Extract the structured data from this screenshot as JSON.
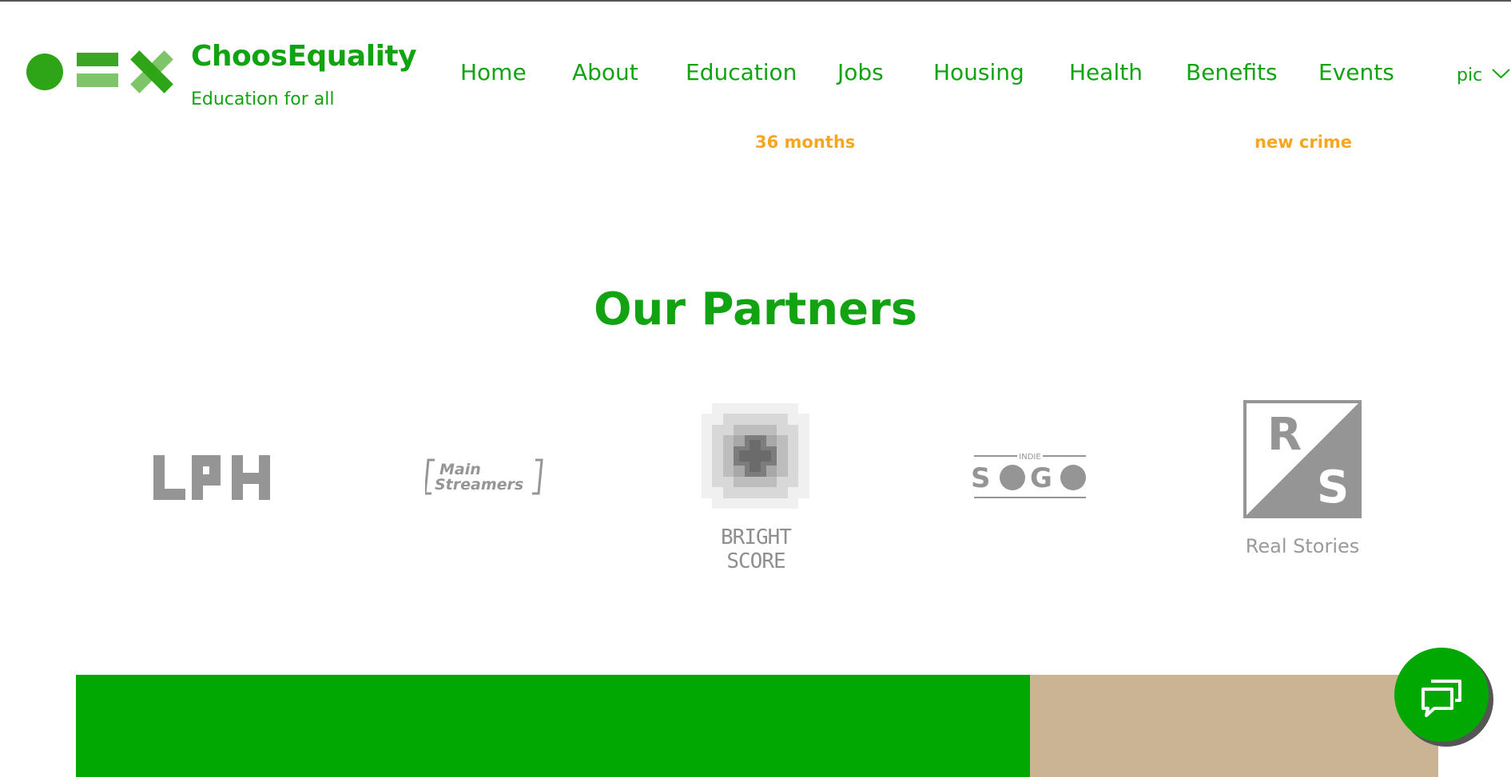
{
  "brand": {
    "name": "ChoosEquality",
    "tagline": "Education for all"
  },
  "nav": {
    "items": [
      {
        "label": "Home"
      },
      {
        "label": "About"
      },
      {
        "label": "Education"
      },
      {
        "label": "Jobs"
      },
      {
        "label": "Housing"
      },
      {
        "label": "Health"
      },
      {
        "label": "Benefits"
      },
      {
        "label": "Events"
      }
    ],
    "language": "pic"
  },
  "stats": {
    "fragment_left": "36 months",
    "fragment_right": "new crime"
  },
  "partners": {
    "title": "Our Partners",
    "logos": [
      {
        "name": "LPH",
        "icon": "lph-logo"
      },
      {
        "name": "Main Streamers",
        "line1": "Main",
        "line2": "Streamers",
        "icon": "main-streamers-logo"
      },
      {
        "name": "BRIGHT SCORE",
        "label": "BRIGHT SCORE",
        "icon": "bright-score-logo"
      },
      {
        "name": "INDIE SOGO",
        "small": "INDIE",
        "word": "SOGO",
        "icon": "indiesogo-logo"
      },
      {
        "name": "Real Stories",
        "label": "Real Stories",
        "letters": [
          "R",
          "S"
        ],
        "icon": "real-stories-logo"
      }
    ]
  },
  "colors": {
    "brand_green": "#11a311",
    "banner_green": "#02a802",
    "banner_tan": "#cab493",
    "stat_orange": "#f5a623",
    "logo_gray": "#959595"
  },
  "chat": {
    "icon": "chat-bubbles-icon"
  }
}
